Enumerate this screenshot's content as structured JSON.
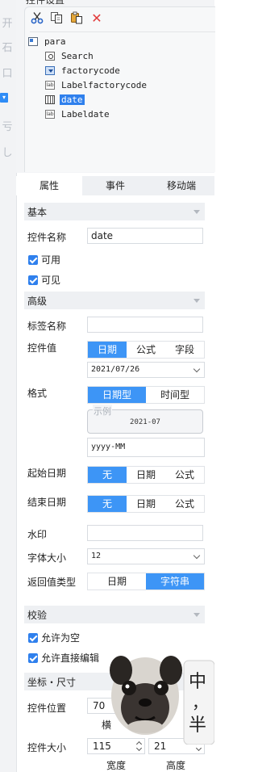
{
  "left_strip": {
    "glyphs": [
      "开",
      "石",
      "口",
      "▾",
      "亏",
      "し"
    ]
  },
  "tree": {
    "partial_title": "控件设置",
    "toolbar": [
      {
        "name": "cut-icon"
      },
      {
        "name": "copy-icon"
      },
      {
        "name": "paste-icon"
      },
      {
        "name": "delete-icon",
        "glyph": "✕"
      }
    ],
    "nodes": [
      {
        "label": "para",
        "icon": "para"
      },
      {
        "label": "Search",
        "icon": "search"
      },
      {
        "label": "factorycode",
        "icon": "combo"
      },
      {
        "label": "Labelfactorycode",
        "icon": "lab"
      },
      {
        "label": "date",
        "icon": "date",
        "selected": true
      },
      {
        "label": "Labeldate",
        "icon": "lab"
      }
    ],
    "lab_text": "lab"
  },
  "tabs": [
    "属性",
    "事件",
    "移动端"
  ],
  "sections": {
    "basic": "基本",
    "advanced": "高级",
    "validation": "校验",
    "coords": "坐标・尺寸"
  },
  "basic": {
    "name_label": "控件名称",
    "name_value": "date",
    "enabled_label": "可用",
    "visible_label": "可见"
  },
  "advanced": {
    "tag_label": "标签名称",
    "tag_value": "",
    "value_label": "控件值",
    "value_options": [
      "日期",
      "公式",
      "字段"
    ],
    "value_date": "2021/07/26",
    "format_label": "格式",
    "format_options": [
      "日期型",
      "时间型"
    ],
    "example_caption": "示例",
    "example_value": "2021-07",
    "format_value": "yyyy-MM",
    "start_label": "起始日期",
    "start_options": [
      "无",
      "日期",
      "公式"
    ],
    "end_label": "结束日期",
    "end_options": [
      "无",
      "日期",
      "公式"
    ],
    "watermark_label": "水印",
    "watermark_value": "",
    "fontsize_label": "字体大小",
    "fontsize_value": "12",
    "return_label": "返回值类型",
    "return_options": [
      "日期",
      "字符串"
    ]
  },
  "validation": {
    "allow_empty": "允许为空",
    "allow_edit": "允许直接编辑"
  },
  "coords": {
    "position_label": "控件位置",
    "position_x": "70",
    "position_caption": "横",
    "size_label": "控件大小",
    "width_value": "115",
    "height_value": "21",
    "width_caption": "宽度",
    "height_caption": "高度"
  },
  "ime": {
    "line1": "中",
    "line2": "，",
    "line3": "半"
  },
  "colors": {
    "accent": "#3d95f6",
    "selected": "#2f80ed",
    "delete": "#e23b3b"
  }
}
